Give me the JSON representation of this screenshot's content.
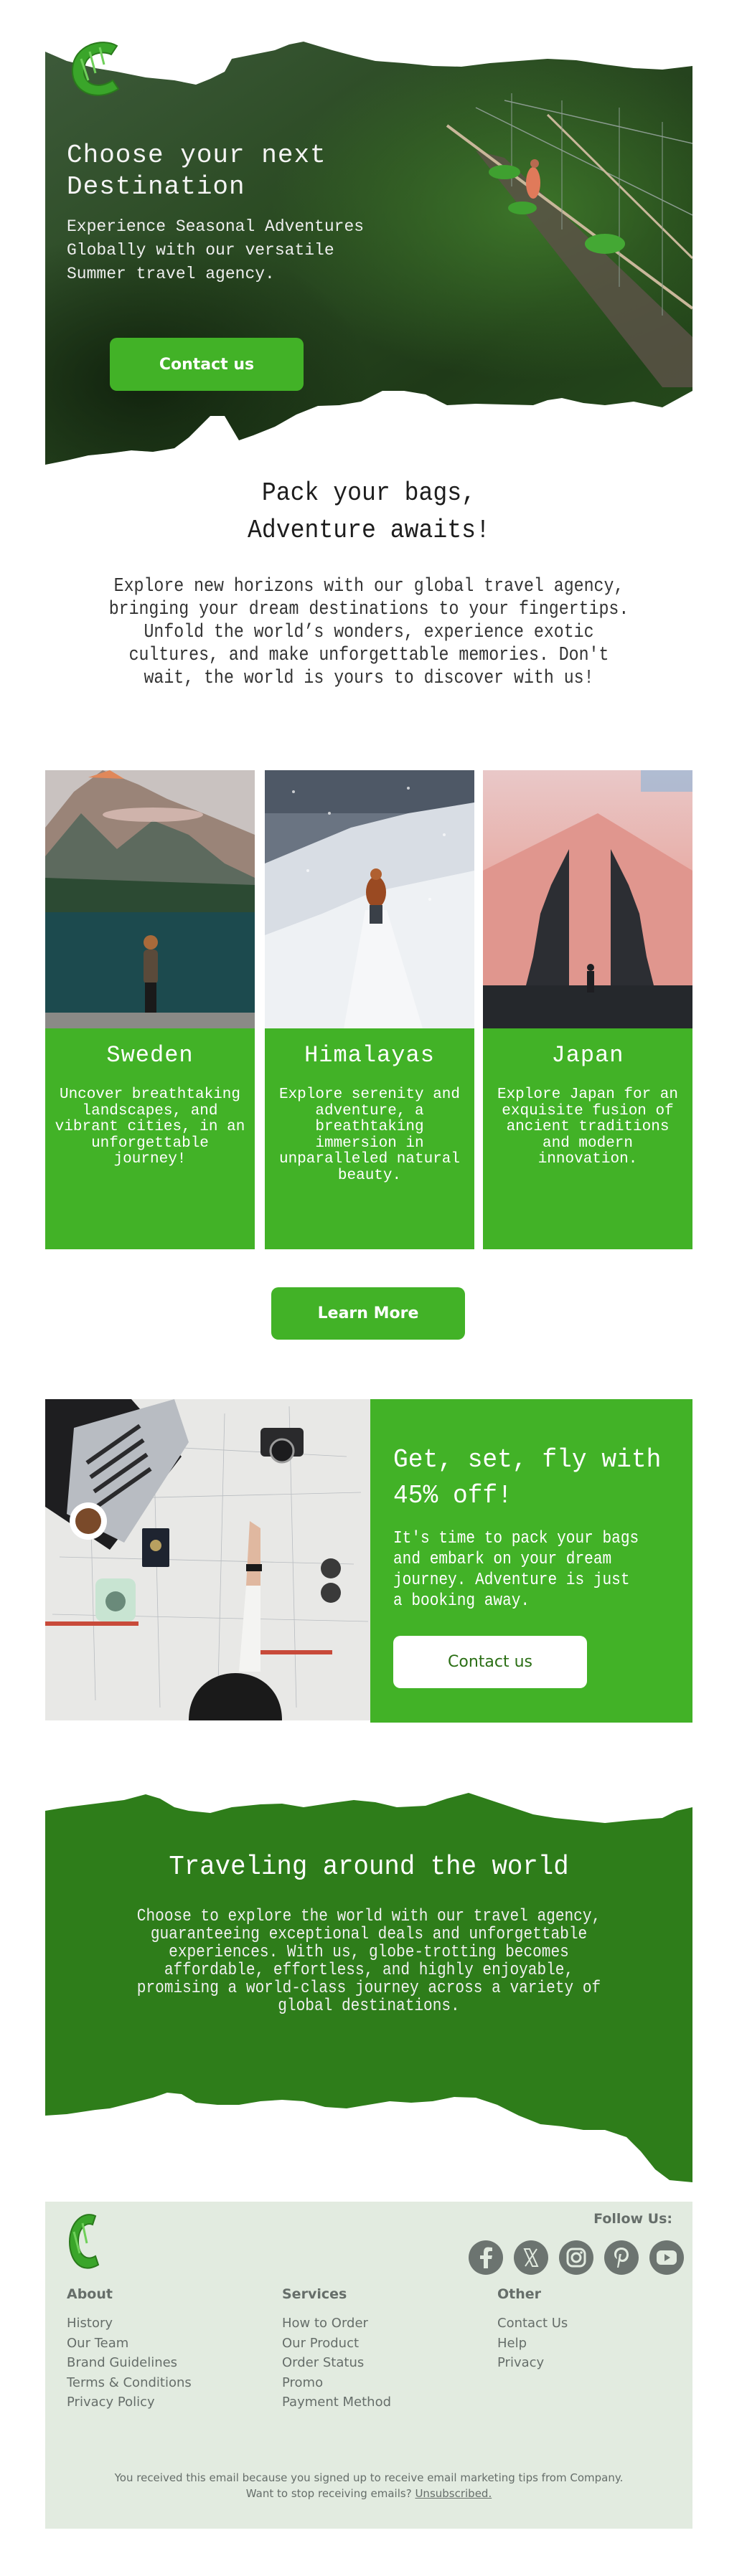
{
  "brand": {
    "logo_alt": "Green C logo",
    "colors": {
      "primary_green": "#42b227",
      "dark_green": "#2e7d1a",
      "footer_bg": "#e2ebe0",
      "footer_text": "#666e6a",
      "white": "#ffffff"
    }
  },
  "hero": {
    "title": "Choose your next Destination",
    "subtitle": "Experience Seasonal Adventures Globally with our versatile Summer travel agency.",
    "cta_label": "Contact us"
  },
  "intro": {
    "title_line1": "Pack your bags,",
    "title_line2": "Adventure awaits!",
    "body": "Explore new horizons with our global travel agency, bringing your dream destinations to your fingertips. Unfold the world’s wonders, experience exotic cultures, and make unforgettable memories. Don't wait, the world is yours to discover with us!"
  },
  "destinations": [
    {
      "name": "Sweden",
      "description": "Uncover breathtaking landscapes, and vibrant cities, in an unforgettable journey!"
    },
    {
      "name": "Himalayas",
      "description": "Explore serenity and adventure, a breathtaking immersion in unparalleled natural beauty."
    },
    {
      "name": "Japan",
      "description": "Explore Japan for an exquisite fusion of ancient traditions and modern innovation."
    }
  ],
  "learn_more_label": "Learn More",
  "promo": {
    "title": "Get, set, fly with 45% off!",
    "discount_percent": 45,
    "text": "It's time to pack your bags and embark on your dream journey. Adventure is just a booking away.",
    "cta_label": "Contact us"
  },
  "world": {
    "title": "Traveling around the world",
    "text": "Choose to explore the world with our travel agency, guaranteeing exceptional deals and unforgettable experiences. With us, globe-trotting becomes affordable, effortless, and highly enjoyable, promising a world-class journey across a variety of global destinations."
  },
  "footer": {
    "follow_label": "Follow Us:",
    "socials": [
      {
        "name": "facebook",
        "icon": "facebook-icon"
      },
      {
        "name": "x",
        "icon": "x-twitter-icon"
      },
      {
        "name": "instagram",
        "icon": "instagram-icon"
      },
      {
        "name": "pinterest",
        "icon": "pinterest-icon"
      },
      {
        "name": "youtube",
        "icon": "youtube-icon"
      }
    ],
    "columns": [
      {
        "heading": "About",
        "links": [
          "History",
          "Our Team",
          "Brand Guidelines",
          "Terms & Conditions",
          "Privacy Policy"
        ]
      },
      {
        "heading": "Services",
        "links": [
          "How to Order",
          "Our Product",
          "Order Status",
          "Promo",
          "Payment Method"
        ]
      },
      {
        "heading": "Other",
        "links": [
          "Contact Us",
          "Help",
          "Privacy"
        ]
      }
    ],
    "note_line1": "You received this email because you signed up to receive email marketing tips from Company.",
    "note_line2": "Want to stop receiving emails?",
    "unsubscribe_label": "Unsubscribed."
  }
}
